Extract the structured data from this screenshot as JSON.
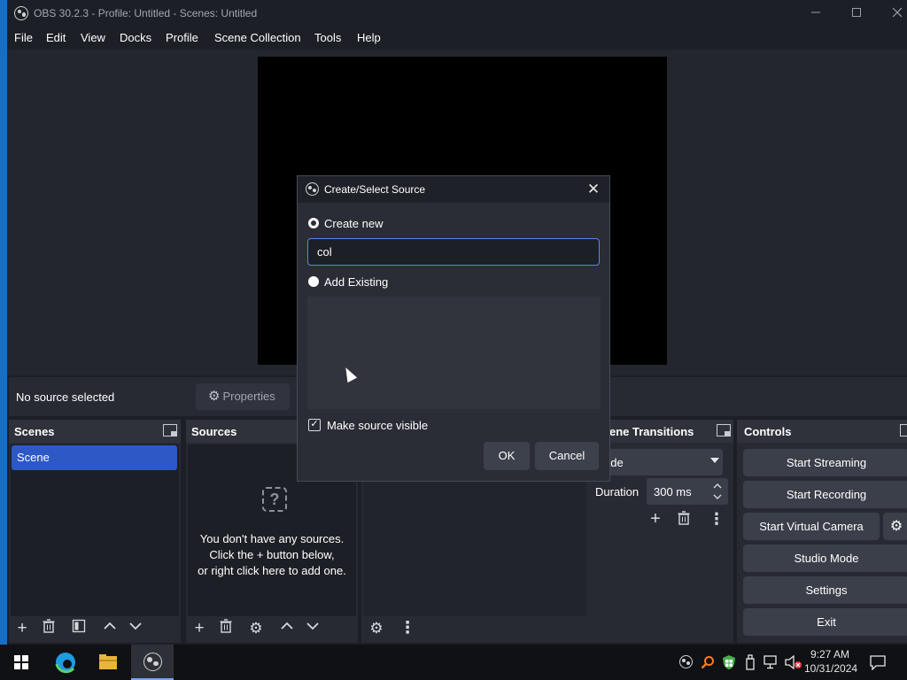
{
  "window": {
    "title": "OBS 30.2.3 - Profile: Untitled - Scenes: Untitled",
    "minimize_icon": "minimize-icon",
    "maximize_icon": "maximize-icon",
    "close_icon": "close-icon"
  },
  "menubar": [
    "File",
    "Edit",
    "View",
    "Docks",
    "Profile",
    "Scene Collection",
    "Tools",
    "Help"
  ],
  "context_bar": {
    "status": "No source selected",
    "properties_label": "Properties"
  },
  "docks": {
    "scenes": {
      "title": "Scenes",
      "items": [
        "Scene"
      ]
    },
    "sources": {
      "title": "Sources",
      "empty_line1": "You don't have any sources.",
      "empty_line2": "Click the + button below,",
      "empty_line3": "or right click here to add one."
    },
    "transitions": {
      "title": "Scene Transitions",
      "visible_title": "ene Transitions",
      "selected": "Fade",
      "visible_selected": "ade",
      "duration_label": "Duration",
      "duration_value": "300 ms"
    },
    "controls": {
      "title": "Controls",
      "buttons": [
        "Start Streaming",
        "Start Recording",
        "Start Virtual Camera",
        "Studio Mode",
        "Settings",
        "Exit"
      ]
    }
  },
  "dialog": {
    "title": "Create/Select Source",
    "create_new_label": "Create new",
    "name_value": "col",
    "add_existing_label": "Add Existing",
    "make_visible_label": "Make source visible",
    "make_visible_checked": true,
    "ok_label": "OK",
    "cancel_label": "Cancel"
  },
  "taskbar": {
    "time": "9:27 AM",
    "date": "10/31/2024"
  },
  "colors": {
    "accent": "#2d58c5",
    "input_focus": "#5a86ea",
    "taskbar_bg": "#101114"
  }
}
